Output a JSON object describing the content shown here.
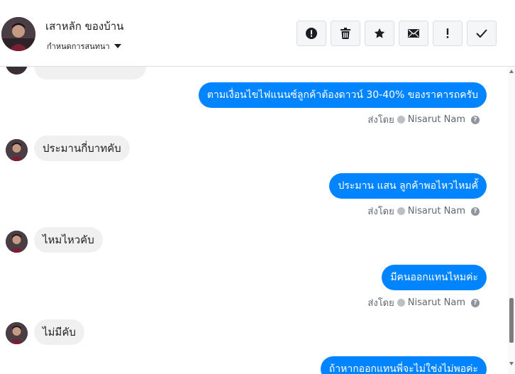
{
  "header": {
    "contact_name": "เสาหลัก ของบ้าน",
    "settings_label": "กำหนดการสนทนา",
    "actions": [
      "mark-spam",
      "delete",
      "star",
      "mark-unread",
      "important",
      "mark-done"
    ]
  },
  "messages": [
    {
      "direction": "out",
      "text": "ตามเงื่อนไขไฟแนนซ์ลูกค้าต้องดาวน์ 30-40% ของราคารถครับ",
      "sender_prefix": "ส่งโดย",
      "sender": "Nisarut Nam"
    },
    {
      "direction": "in",
      "text": "ประมานกี่บาทคับ"
    },
    {
      "direction": "out",
      "text": "ประมาน แสน ลูกค้าพอไหวไหมคั้",
      "sender_prefix": "ส่งโดย",
      "sender": "Nisarut Nam"
    },
    {
      "direction": "in",
      "text": "ไหมไหวคับ"
    },
    {
      "direction": "out",
      "text": "มีคนออกแทนไหมค่ะ",
      "sender_prefix": "ส่งโดย",
      "sender": "Nisarut Nam"
    },
    {
      "direction": "in",
      "text": "ไม่มีคับ"
    },
    {
      "direction": "out",
      "text": "ถ้าหากออกแทนพี่จะไม่ใช่งไม่พอค่ะ"
    }
  ],
  "colors": {
    "outgoing": "#0084ff",
    "incoming": "#f1f0f0",
    "meta": "#606770"
  }
}
